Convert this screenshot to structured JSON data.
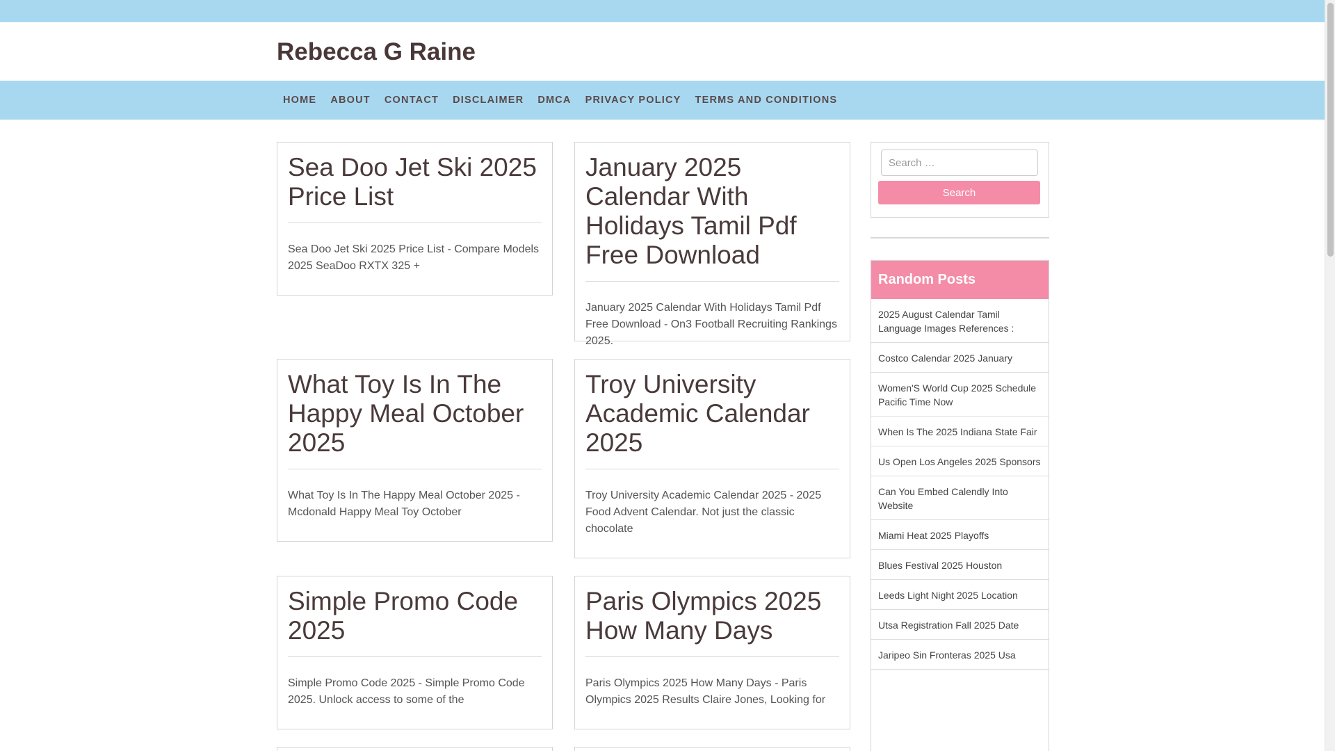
{
  "site": {
    "title": "Rebecca G Raine"
  },
  "nav": {
    "items": [
      {
        "label": "HOME"
      },
      {
        "label": "ABOUT"
      },
      {
        "label": "CONTACT"
      },
      {
        "label": "DISCLAIMER"
      },
      {
        "label": "DMCA"
      },
      {
        "label": "PRIVACY POLICY"
      },
      {
        "label": "TERMS AND CONDITIONS"
      }
    ]
  },
  "posts": [
    {
      "title": "Sea Doo Jet Ski 2025 Price List",
      "excerpt": "Sea Doo Jet Ski 2025 Price List - Compare Models 2025 SeaDoo RXTX 325 +"
    },
    {
      "title": "January 2025 Calendar With Holidays Tamil Pdf Free Download",
      "excerpt": "January 2025 Calendar With Holidays Tamil Pdf Free Download - On3 Football Recruiting Rankings 2025."
    },
    {
      "title": "What Toy Is In The Happy Meal October 2025",
      "excerpt": "What Toy Is In The Happy Meal October 2025 - Mcdonald Happy Meal Toy October"
    },
    {
      "title": "Troy University Academic Calendar 2025",
      "excerpt": "Troy University Academic Calendar 2025 - 2025 Food Advent Calendar. Not just the classic chocolate"
    },
    {
      "title": "Simple Promo Code 2025",
      "excerpt": "Simple Promo Code 2025 - Simple Promo Code 2025. Unlock access to some of the"
    },
    {
      "title": "Paris Olympics 2025 How Many Days",
      "excerpt": "Paris Olympics 2025 How Many Days - Paris Olympics 2025 Results Claire Jones, Looking for"
    }
  ],
  "search": {
    "placeholder": "Search …",
    "button_label": "Search"
  },
  "random_posts": {
    "heading": "Random Posts",
    "items": [
      {
        "label": "2025 August Calendar Tamil Language Images References :"
      },
      {
        "label": "Costco Calendar 2025 January"
      },
      {
        "label": "Women'S World Cup 2025 Schedule Pacific Time Now"
      },
      {
        "label": "When Is The 2025 Indiana State Fair"
      },
      {
        "label": "Us Open Los Angeles 2025 Sponsors"
      },
      {
        "label": "Can You Embed Calendly Into Website"
      },
      {
        "label": "Miami Heat 2025 Playoffs"
      },
      {
        "label": "Blues Festival 2025 Houston"
      },
      {
        "label": "Leeds Light Night 2025 Location"
      },
      {
        "label": "Utsa Registration Fall 2025 Date"
      },
      {
        "label": "Jaripeo Sin Fronteras 2025 Usa"
      }
    ]
  },
  "colors": {
    "accent": "#f48ca8",
    "nav_bg": "#a8d8f0",
    "title": "#4a3838"
  }
}
